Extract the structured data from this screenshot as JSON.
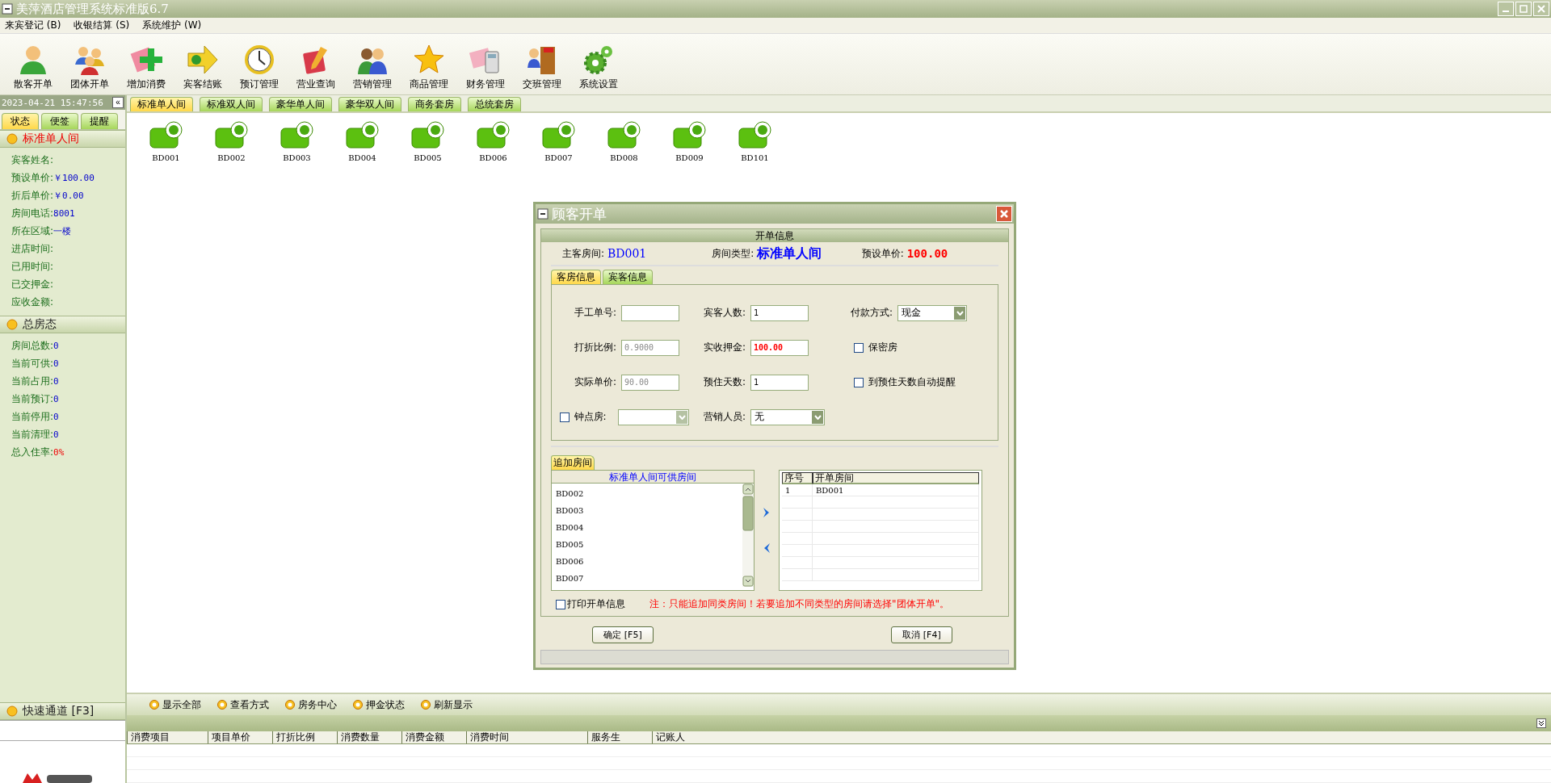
{
  "window": {
    "title": "美萍酒店管理系统标准版6.7"
  },
  "menu": [
    "来宾登记 (B)",
    "收银结算 (S)",
    "系统维护 (W)"
  ],
  "toolbar": [
    {
      "label": "散客开单"
    },
    {
      "label": "团体开单"
    },
    {
      "label": "增加消费"
    },
    {
      "label": "宾客结账"
    },
    {
      "label": "预订管理"
    },
    {
      "label": "营业查询"
    },
    {
      "label": "营销管理"
    },
    {
      "label": "商品管理"
    },
    {
      "label": "财务管理"
    },
    {
      "label": "交班管理"
    },
    {
      "label": "系统设置"
    }
  ],
  "sidebar": {
    "datetime": "2023-04-21 15:47:56",
    "collapse": "«",
    "tabs": [
      {
        "label": "状态",
        "selected": true
      },
      {
        "label": "便签",
        "selected": false
      },
      {
        "label": "提醒",
        "selected": false
      }
    ],
    "room_info": {
      "title": "标准单人间",
      "fields": [
        {
          "label": "宾客姓名:"
        },
        {
          "label": "预设单价:",
          "value": "￥100.00"
        },
        {
          "label": "折后单价:",
          "value": "￥0.00"
        },
        {
          "label": "房间电话:",
          "value": "8001"
        },
        {
          "label": "所在区域:",
          "value": "一楼"
        },
        {
          "label": "进店时间:"
        },
        {
          "label": "已用时间:"
        },
        {
          "label": "已交押金:"
        },
        {
          "label": "应收金额:"
        }
      ]
    },
    "totals": {
      "title": "总房态",
      "fields": [
        {
          "label": "房间总数:",
          "value": "0",
          "warn": false
        },
        {
          "label": "当前可供:",
          "value": "0",
          "warn": false
        },
        {
          "label": "当前占用:",
          "value": "0",
          "warn": false
        },
        {
          "label": "当前预订:",
          "value": "0",
          "warn": false
        },
        {
          "label": "当前停用:",
          "value": "0",
          "warn": false
        },
        {
          "label": "当前清理:",
          "value": "0",
          "warn": false
        },
        {
          "label": "总入住率:",
          "value": "0%",
          "warn": true
        }
      ]
    },
    "quick": {
      "title": "快速通道 [F3]"
    }
  },
  "room_tabs": [
    {
      "label": "标准单人间",
      "selected": true
    },
    {
      "label": "标准双人间",
      "selected": false
    },
    {
      "label": "豪华单人间",
      "selected": false
    },
    {
      "label": "豪华双人间",
      "selected": false
    },
    {
      "label": "商务套房",
      "selected": false
    },
    {
      "label": "总统套房",
      "selected": false
    }
  ],
  "rooms": [
    {
      "label": "BD001"
    },
    {
      "label": "BD002"
    },
    {
      "label": "BD003"
    },
    {
      "label": "BD004"
    },
    {
      "label": "BD005"
    },
    {
      "label": "BD006"
    },
    {
      "label": "BD007"
    },
    {
      "label": "BD008"
    },
    {
      "label": "BD009"
    },
    {
      "label": "BD101"
    }
  ],
  "dialog": {
    "title": "顾客开单",
    "section": "开单信息",
    "main_room": {
      "label": "主客房间:",
      "value": "BD001"
    },
    "room_type": {
      "label": "房间类型:",
      "value": "标准单人间"
    },
    "preset_price": {
      "label": "预设单价:",
      "value": "100.00"
    },
    "tabs": [
      {
        "label": "客房信息",
        "selected": true
      },
      {
        "label": "宾客信息",
        "selected": false
      }
    ],
    "fields": [
      {
        "kind": "input",
        "label": "手工单号:"
      },
      {
        "kind": "input",
        "label": "宾客人数:",
        "value": "1",
        "disabled": false,
        "highlight": false
      },
      {
        "kind": "select",
        "label": "付款方式:",
        "value": "现金",
        "disabled": false
      },
      {
        "kind": "input",
        "label": "打折比例:",
        "value": "0.9000",
        "disabled": true,
        "highlight": false
      },
      {
        "kind": "input",
        "label": "实收押金:",
        "value": "100.00",
        "disabled": false,
        "highlight": true
      },
      {
        "kind": "checkbox",
        "label": "保密房",
        "checked": false
      },
      {
        "kind": "input",
        "label": "实际单价:",
        "value": "90.00",
        "disabled": true,
        "highlight": false
      },
      {
        "kind": "input",
        "label": "预住天数:",
        "value": "1",
        "disabled": false,
        "highlight": false
      },
      {
        "kind": "checkbox",
        "label": "到预住天数自动提醒",
        "checked": false
      },
      {
        "kind": "checkselect",
        "label": "钟点房:",
        "checked": false,
        "disabled": true
      },
      {
        "kind": "select",
        "label": "营销人员:",
        "value": "无",
        "disabled": false
      }
    ],
    "add_tab": {
      "label": "追加房间",
      "selected": true
    },
    "available_title": "标准单人间可供房间",
    "available": [
      "BD002",
      "BD003",
      "BD004",
      "BD005",
      "BD006",
      "BD007"
    ],
    "chosen": {
      "columns": [
        "序号",
        "开单房间"
      ],
      "rows": [
        [
          "1",
          "BD001"
        ]
      ]
    },
    "print": {
      "label": "打印开单信息",
      "checked": false
    },
    "note": "注：只能追加同类房间！若要追加不同类型的房间请选择\"团体开单\"。",
    "buttons": [
      "确定 [F5]",
      "取消 [F4]"
    ]
  },
  "bottom_toolbar": [
    "显示全部",
    "查看方式",
    "房务中心",
    "押金状态",
    "刷新显示"
  ],
  "consume_table": {
    "columns": [
      "消费项目",
      "项目单价",
      "打折比例",
      "消费数量",
      "消费金额",
      "消费时间",
      "服务生",
      "记账人"
    ]
  }
}
